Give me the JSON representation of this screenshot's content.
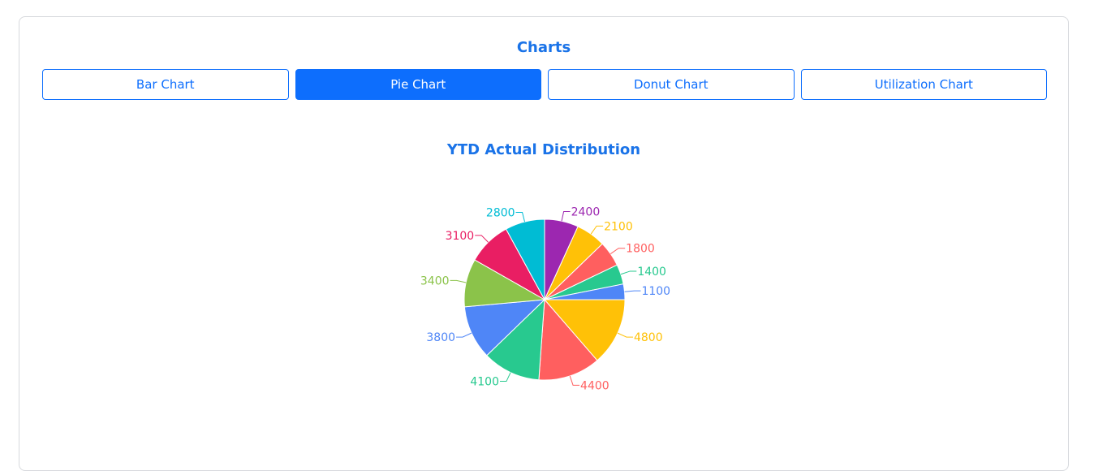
{
  "header": {
    "title": "Charts"
  },
  "tabs": [
    {
      "label": "Bar Chart",
      "active": false
    },
    {
      "label": "Pie Chart",
      "active": true
    },
    {
      "label": "Donut Chart",
      "active": false
    },
    {
      "label": "Utilization Chart",
      "active": false
    }
  ],
  "colors": {
    "accent": "#0d6efd",
    "title": "#1a73e8",
    "border": "#d7d9dd"
  },
  "chart_data": {
    "type": "pie",
    "title": "YTD Actual Distribution",
    "values": [
      4800,
      4400,
      4100,
      3800,
      3400,
      3100,
      2800,
      2400,
      2100,
      1800,
      1400,
      1100
    ],
    "labels": [
      "4800",
      "4400",
      "4100",
      "3800",
      "3400",
      "3100",
      "2800",
      "2400",
      "2100",
      "1800",
      "1400",
      "1100"
    ],
    "colors": [
      "#ffc107",
      "#ff5f5f",
      "#28c98f",
      "#4f86f7",
      "#8bc34a",
      "#e91e63",
      "#00bcd4",
      "#9c27b0",
      "#ffc107",
      "#ff5f5f",
      "#28c98f",
      "#4f86f7"
    ],
    "start": "3 o'clock",
    "direction": "clockwise",
    "legend": "none"
  }
}
